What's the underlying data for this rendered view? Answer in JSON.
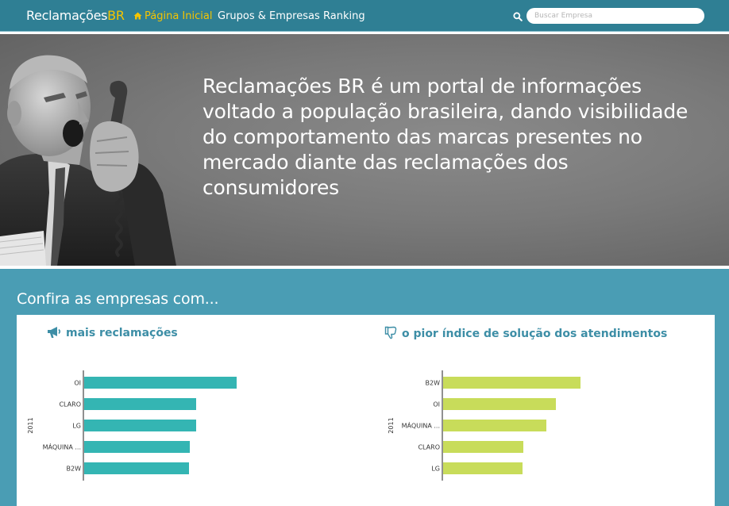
{
  "navbar": {
    "brand_main": "Reclamações",
    "brand_accent": "BR",
    "links": [
      {
        "label": "Página Inicial",
        "active": true
      },
      {
        "label": "Grupos & Empresas",
        "active": false
      },
      {
        "label": "Ranking",
        "active": false
      }
    ],
    "search_placeholder": "Buscar Empresa",
    "search_value": ""
  },
  "hero": {
    "text": "Reclamações BR é um portal de informações voltado a população brasileira, dando visibilidade do comportamento das marcas presentes no mercado diante das reclamações dos consumidores"
  },
  "section": {
    "title": "Confira as empresas com..."
  },
  "colors": {
    "nav_bg": "#2f7f94",
    "page_bg": "#4a9db4",
    "accent_yellow": "#f4c400",
    "chart_teal": "#34b5b3",
    "chart_green": "#c8dc5a",
    "heading_blue": "#3d8ea6"
  },
  "icons": {
    "home": "home-icon",
    "search": "search-icon",
    "megaphone": "megaphone-icon",
    "thumbs_down": "thumbs-down-icon"
  },
  "chart_data": [
    {
      "type": "bar",
      "orientation": "horizontal",
      "title": "mais reclamações",
      "ylabel": "2011",
      "categories": [
        "OI",
        "CLARO",
        "LG",
        "MÁQUINA ...",
        "B2W"
      ],
      "values": [
        192,
        141,
        141,
        133,
        132
      ],
      "xlim": [
        0,
        200
      ],
      "color": "#34b5b3"
    },
    {
      "type": "bar",
      "orientation": "horizontal",
      "title": "o pior índice de solução dos atendimentos",
      "ylabel": "2011",
      "categories": [
        "B2W",
        "OI",
        "MÁQUINA ...",
        "CLARO",
        "LG"
      ],
      "values": [
        173,
        142,
        130,
        101,
        100
      ],
      "xlim": [
        0,
        200
      ],
      "color": "#c8dc5a"
    }
  ]
}
